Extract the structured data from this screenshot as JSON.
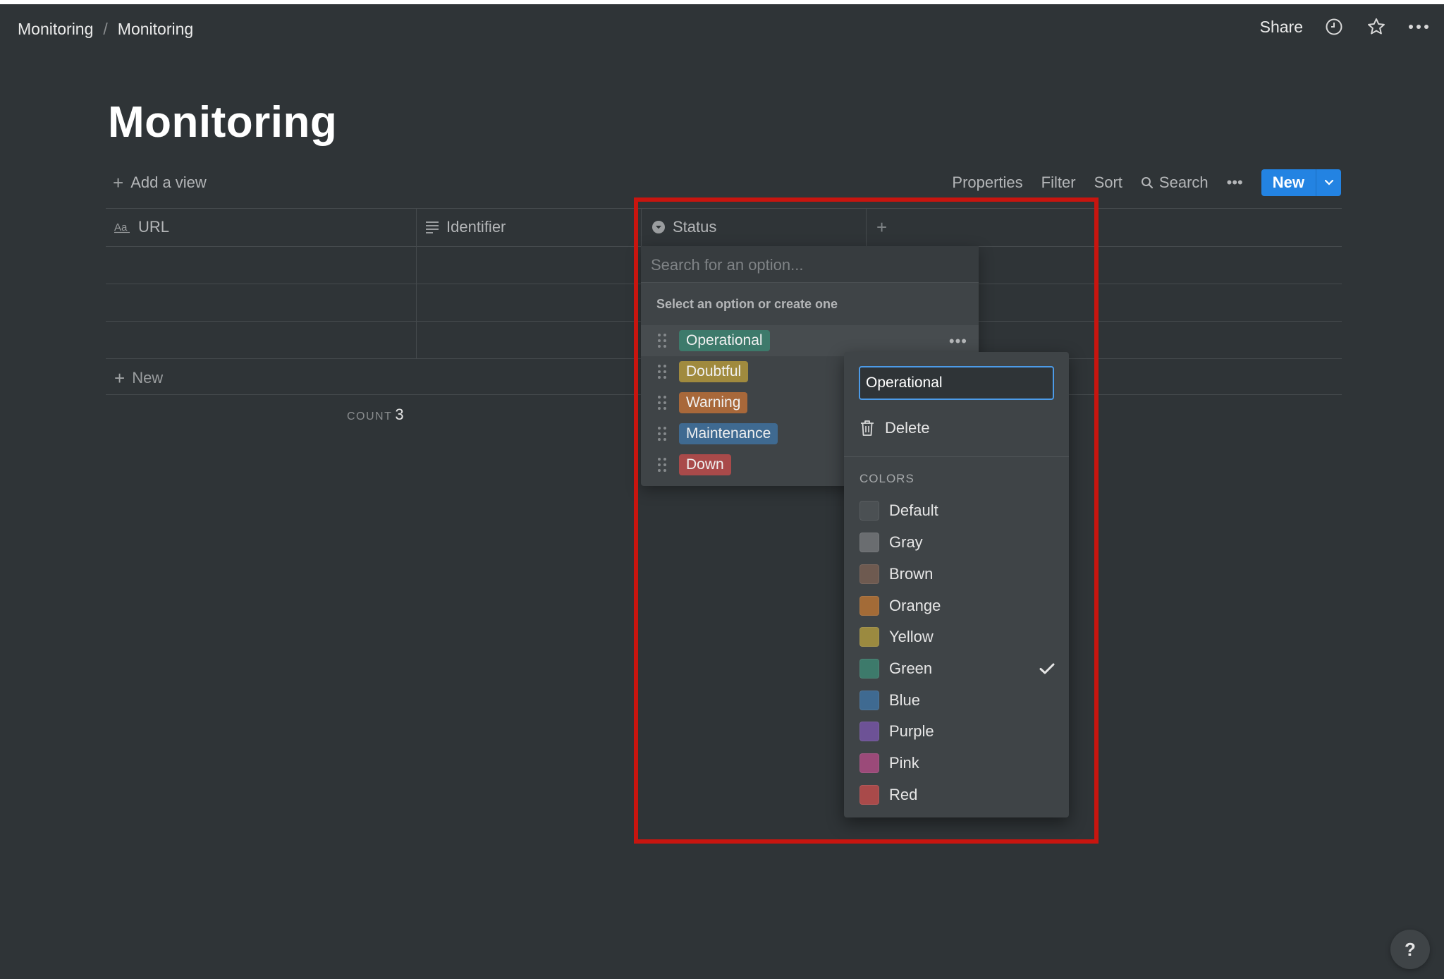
{
  "breadcrumb": {
    "first": "Monitoring",
    "separator": "/",
    "second": "Monitoring"
  },
  "topbar": {
    "share_label": "Share",
    "icons": [
      "clock-icon",
      "star-icon",
      "more-icon"
    ]
  },
  "page": {
    "title": "Monitoring"
  },
  "view_bar": {
    "add_view_label": "Add a view",
    "properties_label": "Properties",
    "filter_label": "Filter",
    "sort_label": "Sort",
    "search_label": "Search",
    "more_label": "•••",
    "new_label": "New"
  },
  "table": {
    "columns": [
      {
        "label": "URL",
        "icon": "text-type-icon"
      },
      {
        "label": "Identifier",
        "icon": "lines-icon"
      },
      {
        "label": "Status",
        "icon": "select-icon"
      }
    ],
    "add_column_label": "+",
    "new_row_label": "New",
    "count_label": "COUNT",
    "count_value": "3"
  },
  "status_dropdown": {
    "search_placeholder": "Search for an option...",
    "hint": "Select an option or create one",
    "options": [
      {
        "label": "Operational",
        "color": "#3d7a6b"
      },
      {
        "label": "Doubtful",
        "color": "#a08a3e"
      },
      {
        "label": "Warning",
        "color": "#a8683a"
      },
      {
        "label": "Maintenance",
        "color": "#3f6a91"
      },
      {
        "label": "Down",
        "color": "#a94a4a"
      }
    ],
    "more_label": "•••"
  },
  "edit_menu": {
    "name_value": "Operational",
    "delete_label": "Delete",
    "colors_heading": "COLORS",
    "selected_color": "Green",
    "colors": [
      {
        "name": "Default",
        "swatch": "#4b5053"
      },
      {
        "name": "Gray",
        "swatch": "#6a6d70"
      },
      {
        "name": "Brown",
        "swatch": "#6e5a50"
      },
      {
        "name": "Orange",
        "swatch": "#a36b37"
      },
      {
        "name": "Yellow",
        "swatch": "#9b8a40"
      },
      {
        "name": "Green",
        "swatch": "#3d7a6b"
      },
      {
        "name": "Blue",
        "swatch": "#3f6a91"
      },
      {
        "name": "Purple",
        "swatch": "#6d5296"
      },
      {
        "name": "Pink",
        "swatch": "#9b4a79"
      },
      {
        "name": "Red",
        "swatch": "#a94a4a"
      }
    ]
  },
  "help": {
    "label": "?"
  },
  "colors": {
    "accent": "#2383e2",
    "highlight": "#c8150f",
    "background": "#2f3437"
  }
}
